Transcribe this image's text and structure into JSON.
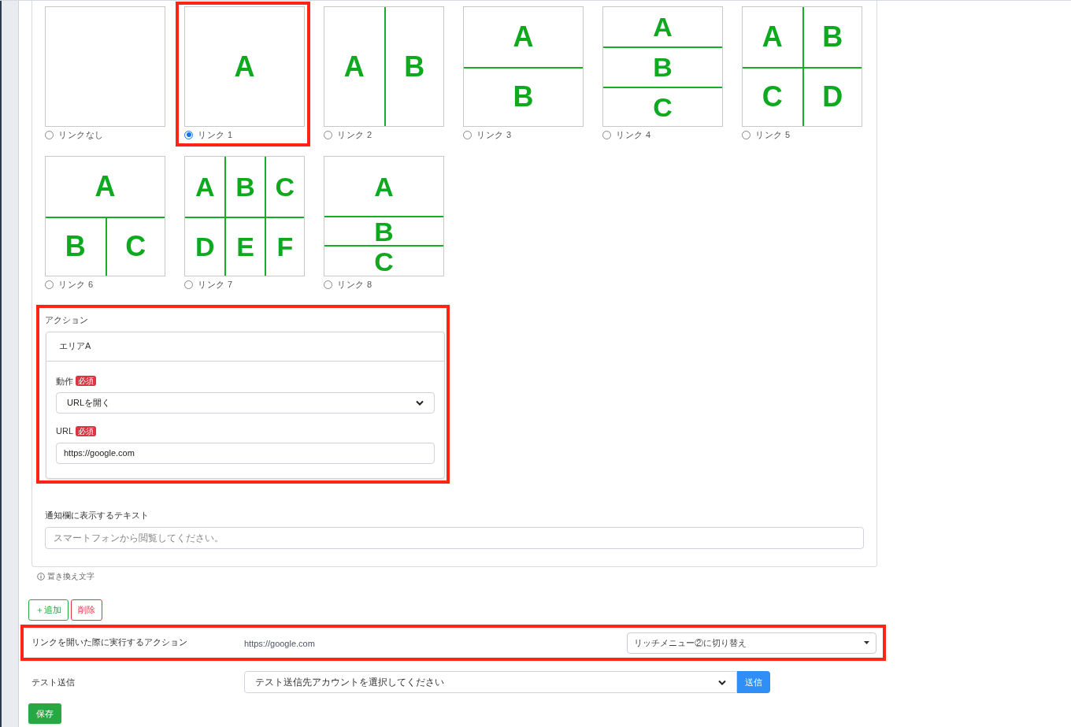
{
  "layouts": [
    {
      "label": "リンクなし",
      "selected": false,
      "highlighted": false,
      "kind": "none"
    },
    {
      "label": "リンク 1",
      "selected": true,
      "highlighted": true,
      "kind": "single",
      "areas": [
        "A"
      ]
    },
    {
      "label": "リンク 2",
      "selected": false,
      "highlighted": false,
      "kind": "cols2",
      "areas": [
        "A",
        "B"
      ]
    },
    {
      "label": "リンク 3",
      "selected": false,
      "highlighted": false,
      "kind": "rows2",
      "areas": [
        "A",
        "B"
      ]
    },
    {
      "label": "リンク 4",
      "selected": false,
      "highlighted": false,
      "kind": "rows3",
      "areas": [
        "A",
        "B",
        "C"
      ]
    },
    {
      "label": "リンク 5",
      "selected": false,
      "highlighted": false,
      "kind": "grid4",
      "areas": [
        "A",
        "B",
        "C",
        "D"
      ]
    },
    {
      "label": "リンク 6",
      "selected": false,
      "highlighted": false,
      "kind": "top1bottom2",
      "areas": [
        "A",
        "B",
        "C"
      ]
    },
    {
      "label": "リンク 7",
      "selected": false,
      "highlighted": false,
      "kind": "grid6",
      "areas": [
        "A",
        "B",
        "C",
        "D",
        "E",
        "F"
      ]
    },
    {
      "label": "リンク 8",
      "selected": false,
      "highlighted": false,
      "kind": "top1small2",
      "areas": [
        "A",
        "B",
        "C"
      ]
    }
  ],
  "action": {
    "label": "アクション",
    "area_title": "エリアA",
    "fields": [
      {
        "label": "動作",
        "badge": "必須",
        "kind": "select",
        "value": "URLを開く"
      },
      {
        "label": "URL",
        "badge": "必須",
        "kind": "text",
        "value": "https://google.com"
      }
    ]
  },
  "notification": {
    "label": "通知欄に表示するテキスト",
    "placeholder": "スマートフォンから閲覧してください。"
  },
  "hint": "置き換え文字",
  "buttons": [
    {
      "label": "＋追加",
      "kind": "add"
    },
    {
      "label": "削除",
      "kind": "delete"
    }
  ],
  "link_action": {
    "label": "リンクを開いた際に実行するアクション",
    "url": "https://google.com",
    "select": "リッチメニュー②に切り替え"
  },
  "test_send": {
    "label": "テスト送信",
    "select": "テスト送信先アカウントを選択してください",
    "button": "送信"
  },
  "save": "保存"
}
